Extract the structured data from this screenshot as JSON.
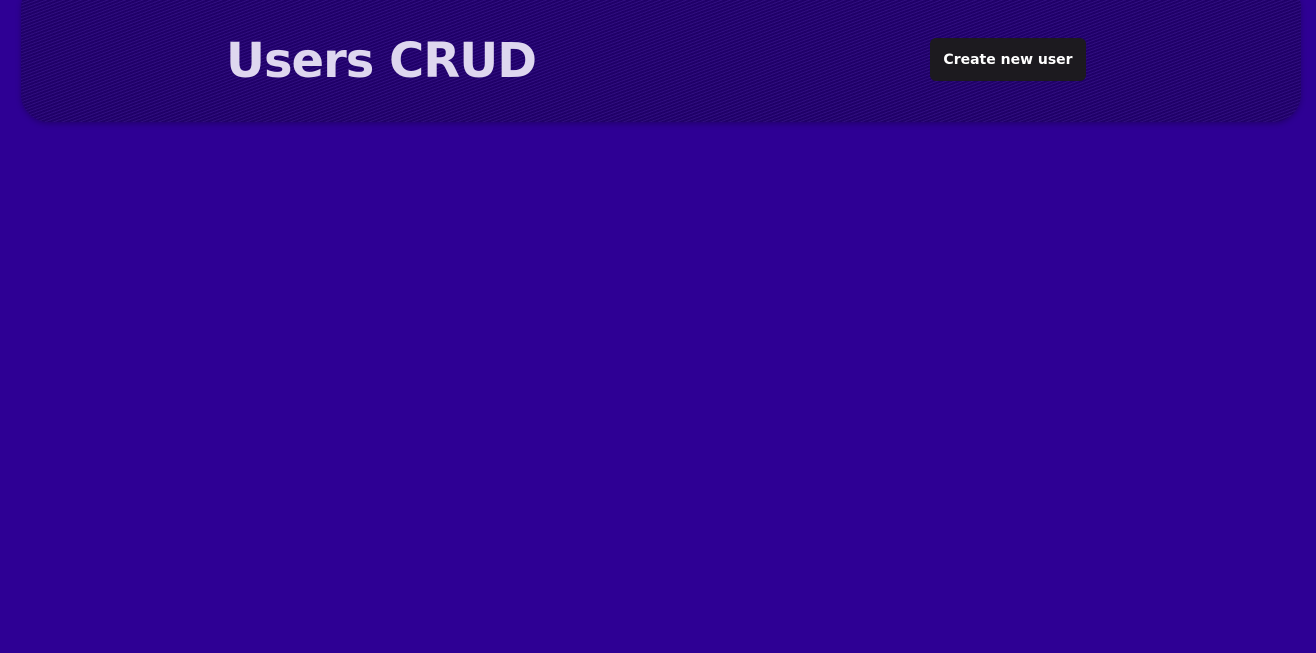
{
  "header": {
    "title": "Users CRUD",
    "create_button_label": "Create new user"
  },
  "colors": {
    "background": "#2e0094",
    "header_background": "#1f0068",
    "title_text": "#ded7ef",
    "button_background": "#1c1a1f",
    "button_text": "#ffffff"
  }
}
